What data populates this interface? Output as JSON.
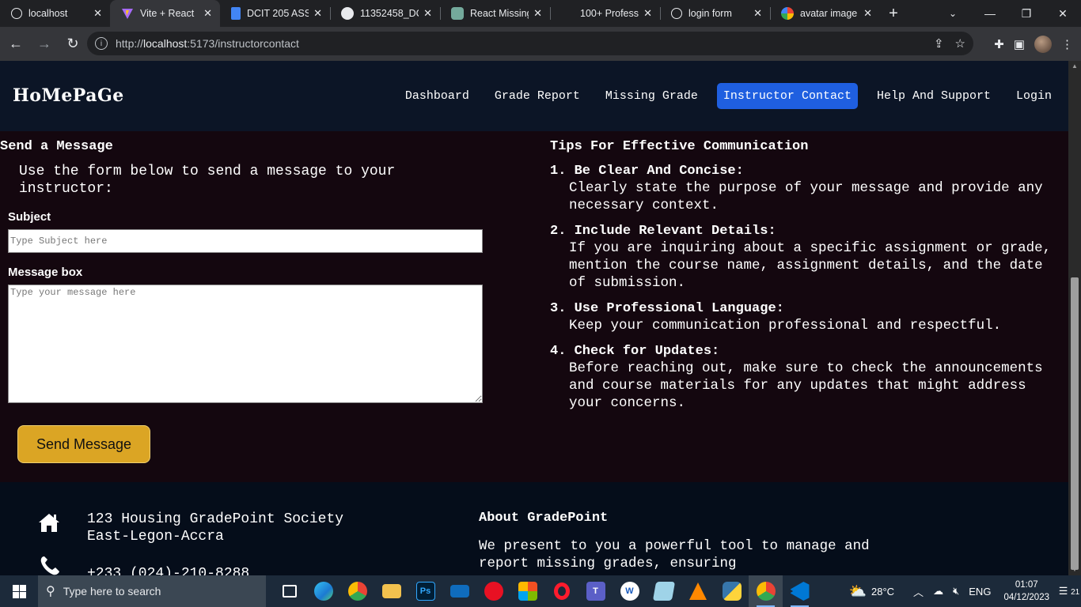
{
  "browser": {
    "tabs": [
      {
        "title": "localhost",
        "icon": "globe-icon",
        "active": false
      },
      {
        "title": "Vite + React",
        "icon": "vite-icon",
        "active": true
      },
      {
        "title": "DCIT 205 ASS",
        "icon": "docs-icon",
        "active": false
      },
      {
        "title": "11352458_DC",
        "icon": "github-icon",
        "active": false
      },
      {
        "title": "React Missing",
        "icon": "chatgpt-icon",
        "active": false
      },
      {
        "title": "100+ Profess",
        "icon": "blank-icon",
        "active": false
      },
      {
        "title": "login form",
        "icon": "globe-icon",
        "active": false
      },
      {
        "title": "avatar image",
        "icon": "google-icon",
        "active": false
      }
    ],
    "url_prefix": "http://",
    "url_host": "localhost",
    "url_rest": ":5173/instructorcontact"
  },
  "site": {
    "logo": "HoMePaGe",
    "nav": [
      {
        "label": "Dashboard",
        "active": false
      },
      {
        "label": "Grade Report",
        "active": false
      },
      {
        "label": "Missing Grade",
        "active": false
      },
      {
        "label": "Instructor Contact",
        "active": true
      },
      {
        "label": "Help And Support",
        "active": false
      },
      {
        "label": "Login",
        "active": false
      }
    ]
  },
  "form": {
    "title": "Send a Message",
    "intro": "Use the form below to send a message to your instructor:",
    "subject_label": "Subject",
    "subject_placeholder": "Type Subject here",
    "message_label": "Message box",
    "message_placeholder": "Type your message here",
    "send_label": "Send Message",
    "send_color": "#dba524"
  },
  "tips": {
    "title": "Tips For Effective Communication",
    "items": [
      {
        "heading": "1. Be Clear And Concise:",
        "body": "Clearly state the purpose of your message and provide any necessary context."
      },
      {
        "heading": "2. Include Relevant Details:",
        "body": "If you are inquiring about a specific assignment or grade, mention the course name, assignment details, and the date of submission."
      },
      {
        "heading": "3. Use Professional Language:",
        "body": "Keep your communication professional and respectful."
      },
      {
        "heading": "4. Check for Updates:",
        "body": "Before reaching out, make sure to check the announcements and course materials for any updates that might address your concerns."
      }
    ]
  },
  "footer": {
    "address_line1": "123 Housing GradePoint Society",
    "address_line2": "East-Legon-Accra",
    "phone": "+233 (024)-210-8288",
    "about_title": "About GradePoint",
    "about_text": "We present to you a powerful tool to manage and report missing grades, ensuring"
  },
  "taskbar": {
    "search_placeholder": "Type here to search",
    "weather": "28°C",
    "lang": "ENG",
    "time": "01:07",
    "date": "04/12/2023",
    "notifications": "21"
  },
  "colors": {
    "accent": "#1f5fe0",
    "header_bg": "#0c1526",
    "page_bg": "#14070f"
  }
}
